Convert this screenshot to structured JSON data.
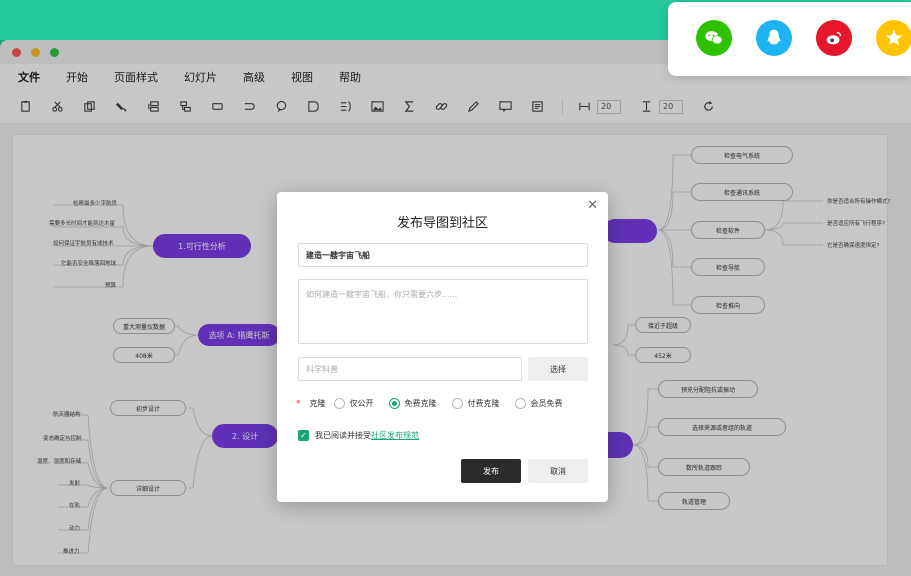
{
  "menubar": {
    "items": [
      "文件",
      "开始",
      "页面样式",
      "幻灯片",
      "高级",
      "视图",
      "帮助"
    ]
  },
  "toolbar": {
    "width_value": "20",
    "height_value": "20"
  },
  "mindmap": {
    "topics": {
      "feasibility": "1.可行性分析",
      "option_a": "选项 A: 猎鹰托斯",
      "design": "2. 设计"
    },
    "left_leaves": [
      "检察最多少字航员",
      "需要多长时间才能到达木星",
      "如何保证宇航员有成技术",
      "它能否安全降落回地球",
      "预算"
    ],
    "option_a_nodes": [
      "重大测量仪数据",
      "408米"
    ],
    "design_nodes": [
      "初步设计",
      "详细设计"
    ],
    "design_leaves": [
      "航天器结构",
      "姿态确定与控制",
      "温度、湿度和存储",
      "发射",
      "在轨",
      "动力",
      "推进力"
    ],
    "right_nodes_top": [
      "检查电气系统",
      "检查通讯系统",
      "检查软件",
      "检查导航",
      "检查推向"
    ],
    "software_leaves": [
      "你是否适合所有操作模式?",
      "是否适应所有飞行程序?",
      "它是否确保速度恒定?"
    ],
    "right_mid_nodes": [
      "接近于超级",
      "452米"
    ],
    "right_nodes_bottom": [
      "预充分配阻抗或振动",
      "选择来源或者组的轨道",
      "数所轨道跟踪",
      "轨道管理"
    ]
  },
  "dialog": {
    "title": "发布导图到社区",
    "close": "✕",
    "title_value": "建造一艘宇宙飞船",
    "desc_placeholder": "如何建造一艘宇宙飞船，你只需要六步......",
    "tag_placeholder": "科学科普",
    "select_label": "选择",
    "req_mark": "*",
    "clone_label": "克隆",
    "options": [
      "仅公开",
      "免费克隆",
      "付费克隆",
      "会员免费"
    ],
    "agree_text": "我已阅读并接受",
    "agree_link": "社区发布规范",
    "publish_label": "发布",
    "cancel_label": "取消"
  },
  "share": {
    "icons": [
      "wechat-icon",
      "qq-icon",
      "weibo-icon",
      "qzone-icon"
    ],
    "colors": [
      "#2dc100",
      "#1eb4f4",
      "#e6162d",
      "#ffc300"
    ]
  }
}
